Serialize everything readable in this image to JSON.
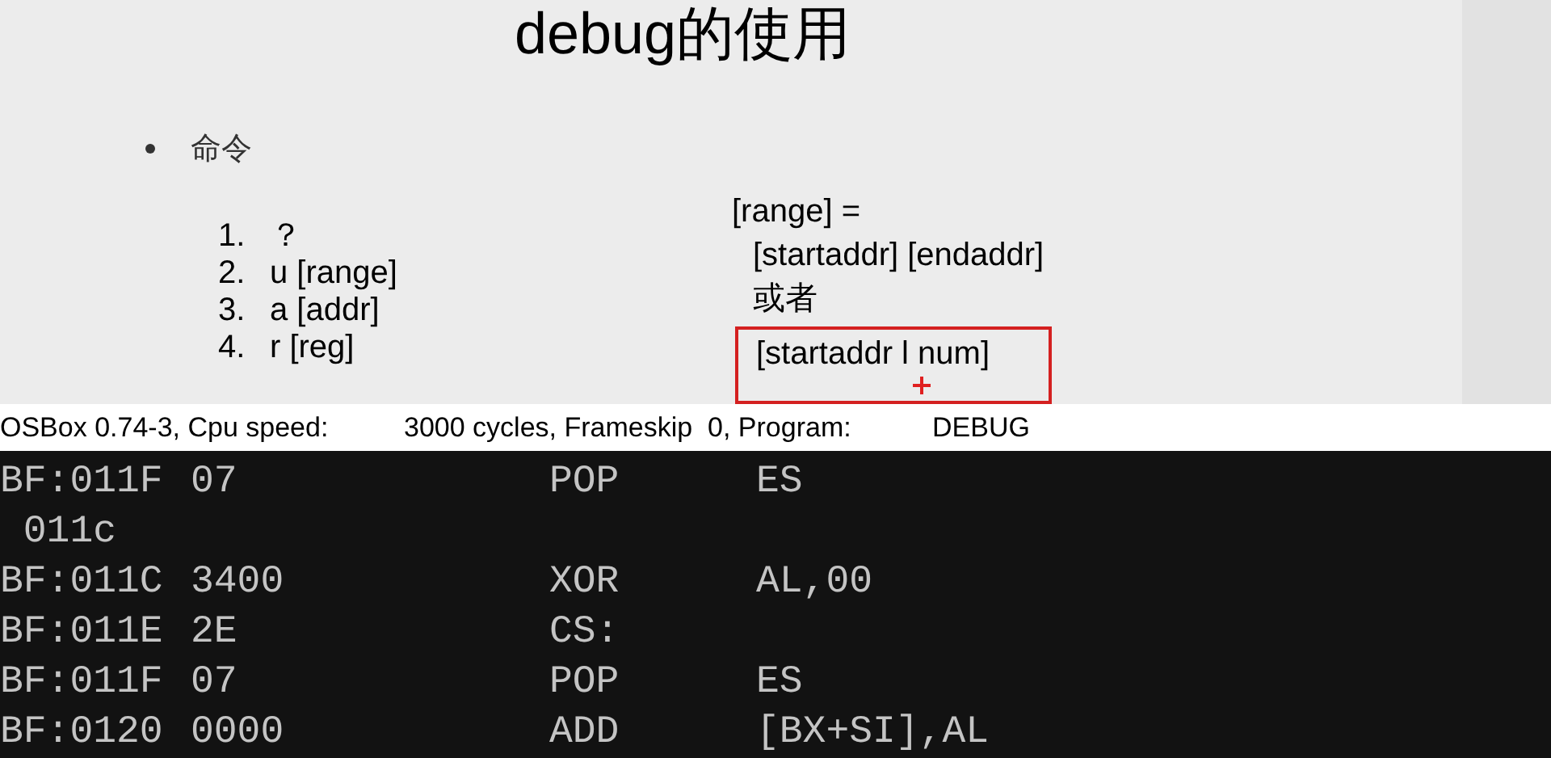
{
  "slide": {
    "title": "debug的使用",
    "bullet": "命令",
    "commands": [
      {
        "number": "1.",
        "text": "？"
      },
      {
        "number": "2.",
        "text": "u [range]"
      },
      {
        "number": "3.",
        "text": "a [addr]"
      },
      {
        "number": "4.",
        "text": "r [reg]"
      }
    ],
    "range_note": [
      {
        "text": "[range] =",
        "indented": false,
        "highlighted": false
      },
      {
        "text": "[startaddr] [endaddr]",
        "indented": true,
        "highlighted": false
      },
      {
        "text": "或者",
        "indented": true,
        "highlighted": false
      },
      {
        "text": "[startaddr l num]",
        "indented": true,
        "highlighted": true
      }
    ]
  },
  "dosbox": {
    "status": [
      "OSBox 0.74-3, Cpu speed:",
      "3000 cycles, Frameskip  0, Program:",
      "DEBUG"
    ],
    "rows": [
      {
        "address": "BF:011F",
        "bytes": "07",
        "mnemonic": "POP",
        "operands": "ES"
      },
      {
        "address": " 011c"
      },
      {
        "address": "BF:011C",
        "bytes": "3400",
        "mnemonic": "XOR",
        "operands": "AL,00"
      },
      {
        "address": "BF:011E",
        "bytes": "2E",
        "mnemonic": "CS:"
      },
      {
        "address": "BF:011F",
        "bytes": "07",
        "mnemonic": "POP",
        "operands": "ES"
      },
      {
        "address": "BF:0120",
        "bytes": "0000",
        "mnemonic": "ADD",
        "operands": "[BX+SI],AL"
      }
    ]
  }
}
